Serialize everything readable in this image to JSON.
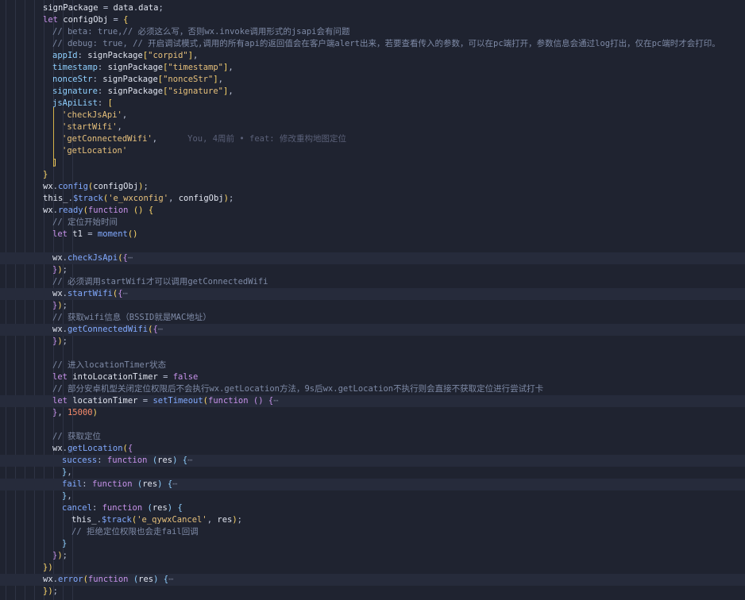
{
  "editor": {
    "lines": [
      {
        "indent": 4,
        "tokens": [
          [
            "v",
            "signPackage"
          ],
          [
            "o",
            " = "
          ],
          [
            "v",
            "data"
          ],
          [
            "o",
            "."
          ],
          [
            "v",
            "data"
          ],
          [
            "o",
            ";"
          ]
        ]
      },
      {
        "indent": 4,
        "tokens": [
          [
            "k",
            "let"
          ],
          [
            "o",
            " "
          ],
          [
            "v",
            "configObj"
          ],
          [
            "o",
            " = "
          ],
          [
            "y",
            "{"
          ]
        ]
      },
      {
        "indent": 5,
        "tokens": [
          [
            "c",
            "// beta: true,// 必须这么写，否则wx.invoke调用形式的jsapi会有问题"
          ]
        ]
      },
      {
        "indent": 5,
        "tokens": [
          [
            "c",
            "// debug: true, // 开启调试模式,调用的所有api的返回值会在客户端alert出来，若要查看传入的参数，可以在pc端打开，参数信息会通过log打出，仅在pc端时才会打印。"
          ]
        ]
      },
      {
        "indent": 5,
        "tokens": [
          [
            "p",
            "appId"
          ],
          [
            "o",
            ": "
          ],
          [
            "v",
            "signPackage"
          ],
          [
            "y",
            "["
          ],
          [
            "s",
            "\"corpid\""
          ],
          [
            "y",
            "]"
          ],
          [
            "o",
            ","
          ]
        ]
      },
      {
        "indent": 5,
        "tokens": [
          [
            "p",
            "timestamp"
          ],
          [
            "o",
            ": "
          ],
          [
            "v",
            "signPackage"
          ],
          [
            "y",
            "["
          ],
          [
            "s",
            "\"timestamp\""
          ],
          [
            "y",
            "]"
          ],
          [
            "o",
            ","
          ]
        ]
      },
      {
        "indent": 5,
        "tokens": [
          [
            "p",
            "nonceStr"
          ],
          [
            "o",
            ": "
          ],
          [
            "v",
            "signPackage"
          ],
          [
            "y",
            "["
          ],
          [
            "s",
            "\"nonceStr\""
          ],
          [
            "y",
            "]"
          ],
          [
            "o",
            ","
          ]
        ]
      },
      {
        "indent": 5,
        "tokens": [
          [
            "p",
            "signature"
          ],
          [
            "o",
            ": "
          ],
          [
            "v",
            "signPackage"
          ],
          [
            "y",
            "["
          ],
          [
            "s",
            "\"signature\""
          ],
          [
            "y",
            "]"
          ],
          [
            "o",
            ","
          ]
        ]
      },
      {
        "indent": 5,
        "tokens": [
          [
            "p",
            "jsApiList"
          ],
          [
            "o",
            ": "
          ],
          [
            "y",
            "["
          ]
        ]
      },
      {
        "indent": 6,
        "tokens": [
          [
            "s",
            "'checkJsApi'"
          ],
          [
            "o",
            ","
          ]
        ]
      },
      {
        "indent": 6,
        "tokens": [
          [
            "s",
            "'startWifi'"
          ],
          [
            "o",
            ","
          ]
        ]
      },
      {
        "indent": 6,
        "tokens": [
          [
            "s",
            "'getConnectedWifi'"
          ],
          [
            "o",
            ","
          ]
        ],
        "blame": "You, 4周前 • feat: 修改重构地图定位"
      },
      {
        "indent": 6,
        "tokens": [
          [
            "s",
            "'getLocation'"
          ]
        ]
      },
      {
        "indent": 5,
        "tokens": [
          [
            "y",
            "]"
          ]
        ]
      },
      {
        "indent": 4,
        "tokens": [
          [
            "y",
            "}"
          ]
        ]
      },
      {
        "indent": 4,
        "tokens": [
          [
            "v",
            "wx"
          ],
          [
            "o",
            "."
          ],
          [
            "f",
            "config"
          ],
          [
            "y",
            "("
          ],
          [
            "v",
            "configObj"
          ],
          [
            "y",
            ")"
          ],
          [
            "o",
            ";"
          ]
        ]
      },
      {
        "indent": 4,
        "tokens": [
          [
            "v",
            "this_"
          ],
          [
            "o",
            "."
          ],
          [
            "f",
            "$track"
          ],
          [
            "y",
            "("
          ],
          [
            "s",
            "'e_wxconfig'"
          ],
          [
            "o",
            ", "
          ],
          [
            "v",
            "configObj"
          ],
          [
            "y",
            ")"
          ],
          [
            "o",
            ";"
          ]
        ]
      },
      {
        "indent": 4,
        "tokens": [
          [
            "v",
            "wx"
          ],
          [
            "o",
            "."
          ],
          [
            "f",
            "ready"
          ],
          [
            "y",
            "("
          ],
          [
            "k",
            "function"
          ],
          [
            "o",
            " "
          ],
          [
            "y",
            "()"
          ],
          [
            "o",
            " "
          ],
          [
            "y",
            "{"
          ]
        ]
      },
      {
        "indent": 5,
        "tokens": [
          [
            "c",
            "// 定位开始时间"
          ]
        ]
      },
      {
        "indent": 5,
        "tokens": [
          [
            "k",
            "let"
          ],
          [
            "o",
            " "
          ],
          [
            "v",
            "t1"
          ],
          [
            "o",
            " = "
          ],
          [
            "f",
            "moment"
          ],
          [
            "y",
            "()"
          ]
        ]
      },
      {
        "indent": 5,
        "tokens": []
      },
      {
        "indent": 5,
        "hl": true,
        "tokens": [
          [
            "v",
            "wx"
          ],
          [
            "o",
            "."
          ],
          [
            "f",
            "checkJsApi"
          ],
          [
            "y",
            "("
          ],
          [
            "k",
            "{"
          ],
          [
            "x",
            "⋯"
          ]
        ]
      },
      {
        "indent": 5,
        "tokens": [
          [
            "k",
            "}"
          ],
          [
            "y",
            ")"
          ],
          [
            "o",
            ";"
          ]
        ]
      },
      {
        "indent": 5,
        "tokens": [
          [
            "c",
            "// 必须调用startWifi才可以调用getConnectedWifi"
          ]
        ]
      },
      {
        "indent": 5,
        "hl": true,
        "tokens": [
          [
            "v",
            "wx"
          ],
          [
            "o",
            "."
          ],
          [
            "f",
            "startWifi"
          ],
          [
            "y",
            "("
          ],
          [
            "k",
            "{"
          ],
          [
            "x",
            "⋯"
          ]
        ]
      },
      {
        "indent": 5,
        "tokens": [
          [
            "k",
            "}"
          ],
          [
            "y",
            ")"
          ],
          [
            "o",
            ";"
          ]
        ]
      },
      {
        "indent": 5,
        "tokens": [
          [
            "c",
            "// 获取wifi信息（BSSID就是MAC地址）"
          ]
        ]
      },
      {
        "indent": 5,
        "hl": true,
        "tokens": [
          [
            "v",
            "wx"
          ],
          [
            "o",
            "."
          ],
          [
            "f",
            "getConnectedWifi"
          ],
          [
            "y",
            "("
          ],
          [
            "k",
            "{"
          ],
          [
            "x",
            "⋯"
          ]
        ]
      },
      {
        "indent": 5,
        "tokens": [
          [
            "k",
            "}"
          ],
          [
            "y",
            ")"
          ],
          [
            "o",
            ";"
          ]
        ]
      },
      {
        "indent": 5,
        "tokens": []
      },
      {
        "indent": 5,
        "tokens": [
          [
            "c",
            "// 进入locationTimer状态"
          ]
        ]
      },
      {
        "indent": 5,
        "tokens": [
          [
            "k",
            "let"
          ],
          [
            "o",
            " "
          ],
          [
            "v",
            "intoLocationTimer"
          ],
          [
            "o",
            " = "
          ],
          [
            "k",
            "false"
          ]
        ]
      },
      {
        "indent": 5,
        "tokens": [
          [
            "c",
            "// 部分安卓机型关闭定位权限后不会执行wx.getLocation方法，9s后wx.getLocation不执行则会直接不获取定位进行尝试打卡"
          ]
        ]
      },
      {
        "indent": 5,
        "hl": true,
        "tokens": [
          [
            "k",
            "let"
          ],
          [
            "o",
            " "
          ],
          [
            "v",
            "locationTimer"
          ],
          [
            "o",
            " = "
          ],
          [
            "f",
            "setTimeout"
          ],
          [
            "y",
            "("
          ],
          [
            "k",
            "function"
          ],
          [
            "o",
            " "
          ],
          [
            "k",
            "()"
          ],
          [
            "o",
            " "
          ],
          [
            "k",
            "{"
          ],
          [
            "x",
            "⋯"
          ]
        ]
      },
      {
        "indent": 5,
        "tokens": [
          [
            "k",
            "}"
          ],
          [
            "o",
            ", "
          ],
          [
            "n",
            "15000"
          ],
          [
            "y",
            ")"
          ]
        ]
      },
      {
        "indent": 5,
        "tokens": []
      },
      {
        "indent": 5,
        "tokens": [
          [
            "c",
            "// 获取定位"
          ]
        ]
      },
      {
        "indent": 5,
        "tokens": [
          [
            "v",
            "wx"
          ],
          [
            "o",
            "."
          ],
          [
            "f",
            "getLocation"
          ],
          [
            "y",
            "("
          ],
          [
            "k",
            "{"
          ]
        ]
      },
      {
        "indent": 6,
        "hl": true,
        "tokens": [
          [
            "f",
            "success"
          ],
          [
            "o",
            ": "
          ],
          [
            "k",
            "function"
          ],
          [
            "o",
            " "
          ],
          [
            "p",
            "("
          ],
          [
            "v",
            "res"
          ],
          [
            "p",
            ")"
          ],
          [
            "o",
            " "
          ],
          [
            "p",
            "{"
          ],
          [
            "x",
            "⋯"
          ]
        ]
      },
      {
        "indent": 6,
        "tokens": [
          [
            "p",
            "}"
          ],
          [
            "o",
            ","
          ]
        ]
      },
      {
        "indent": 6,
        "hl": true,
        "tokens": [
          [
            "f",
            "fail"
          ],
          [
            "o",
            ": "
          ],
          [
            "k",
            "function"
          ],
          [
            "o",
            " "
          ],
          [
            "p",
            "("
          ],
          [
            "v",
            "res"
          ],
          [
            "p",
            ")"
          ],
          [
            "o",
            " "
          ],
          [
            "p",
            "{"
          ],
          [
            "x",
            "⋯"
          ]
        ]
      },
      {
        "indent": 6,
        "tokens": [
          [
            "p",
            "}"
          ],
          [
            "o",
            ","
          ]
        ]
      },
      {
        "indent": 6,
        "tokens": [
          [
            "f",
            "cancel"
          ],
          [
            "o",
            ": "
          ],
          [
            "k",
            "function"
          ],
          [
            "o",
            " "
          ],
          [
            "p",
            "("
          ],
          [
            "v",
            "res"
          ],
          [
            "p",
            ")"
          ],
          [
            "o",
            " "
          ],
          [
            "p",
            "{"
          ]
        ]
      },
      {
        "indent": 7,
        "tokens": [
          [
            "v",
            "this_"
          ],
          [
            "o",
            "."
          ],
          [
            "f",
            "$track"
          ],
          [
            "y",
            "("
          ],
          [
            "s",
            "'e_qywxCancel'"
          ],
          [
            "o",
            ", "
          ],
          [
            "v",
            "res"
          ],
          [
            "y",
            ")"
          ],
          [
            "o",
            ";"
          ]
        ]
      },
      {
        "indent": 7,
        "tokens": [
          [
            "c",
            "// 拒绝定位权限也会走fail回调"
          ]
        ]
      },
      {
        "indent": 6,
        "tokens": [
          [
            "p",
            "}"
          ]
        ]
      },
      {
        "indent": 5,
        "tokens": [
          [
            "k",
            "}"
          ],
          [
            "y",
            ")"
          ],
          [
            "o",
            ";"
          ]
        ]
      },
      {
        "indent": 4,
        "tokens": [
          [
            "y",
            "})"
          ]
        ]
      },
      {
        "indent": 4,
        "hl": true,
        "tokens": [
          [
            "v",
            "wx"
          ],
          [
            "o",
            "."
          ],
          [
            "f",
            "error"
          ],
          [
            "y",
            "("
          ],
          [
            "k",
            "function"
          ],
          [
            "o",
            " "
          ],
          [
            "p",
            "("
          ],
          [
            "v",
            "res"
          ],
          [
            "p",
            ")"
          ],
          [
            "o",
            " "
          ],
          [
            "p",
            "{"
          ],
          [
            "x",
            "⋯"
          ]
        ]
      },
      {
        "indent": 4,
        "tokens": [
          [
            "y",
            "})"
          ],
          [
            "o",
            ";"
          ]
        ]
      }
    ]
  }
}
